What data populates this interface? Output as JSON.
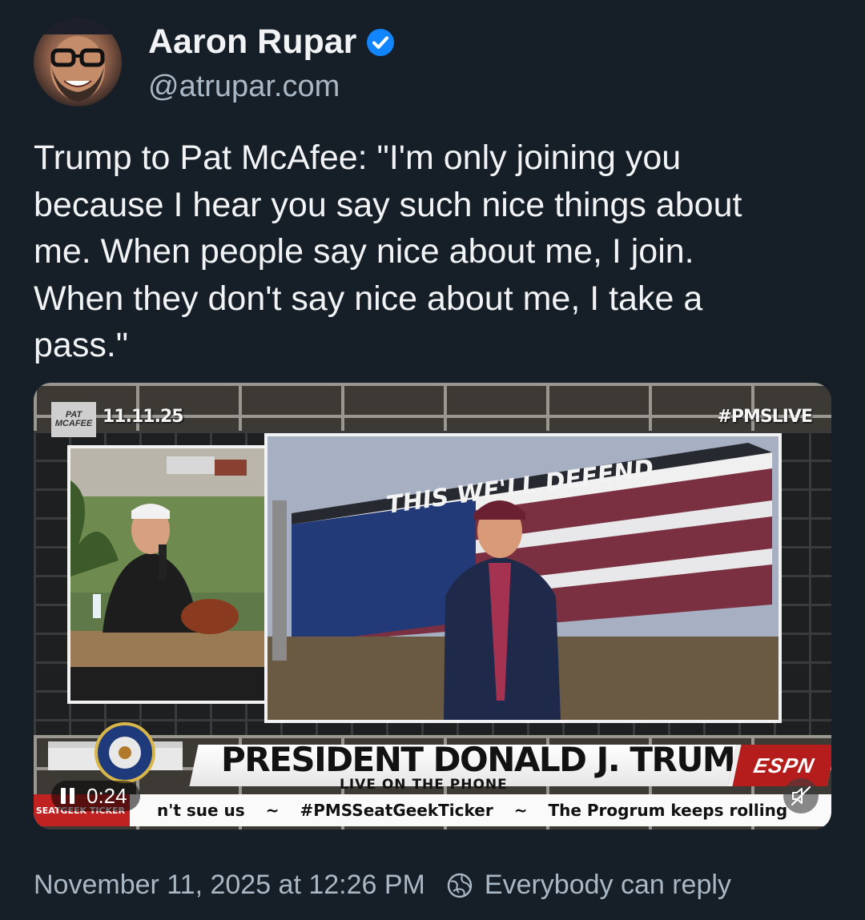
{
  "author": {
    "name": "Aaron Rupar",
    "handle": "@atrupar.com",
    "verified_color": "#1185fe",
    "avatar_icon": "avatar"
  },
  "post": {
    "text_lines": [
      "Trump to Pat McAfee: \"I'm only joining you",
      "because I hear you say such nice things about",
      "me. When people say nice about me, I join.",
      "When they don't say nice about me, I take a",
      "pass.\""
    ]
  },
  "video": {
    "date_overlay": "11.11.25",
    "hashtag_overlay": "#PMSLIVE",
    "show_logo": "PAT MCAFEE",
    "banner_text": "THIS WE'LL DEFEND",
    "lower_third_title": "PRESIDENT DONALD J. TRUMP",
    "lower_third_subtitle": "LIVE ON THE PHONE",
    "network_logo": "ESPN",
    "ticker_logo": "SEATGEEK TICKER",
    "ticker_items": [
      "n't sue us",
      "~",
      "#PMSSeatGeekTicker",
      "~",
      "The Progrum keeps rolling"
    ],
    "elapsed": "0:24",
    "playback_state": "playing",
    "muted": true
  },
  "footer": {
    "timestamp": "November 11, 2025 at 12:26 PM",
    "reply_setting": "Everybody can reply"
  },
  "colors": {
    "background": "#161e27",
    "text": "#f1f3f5",
    "secondary": "#aab8c5",
    "accent": "#1185fe"
  }
}
